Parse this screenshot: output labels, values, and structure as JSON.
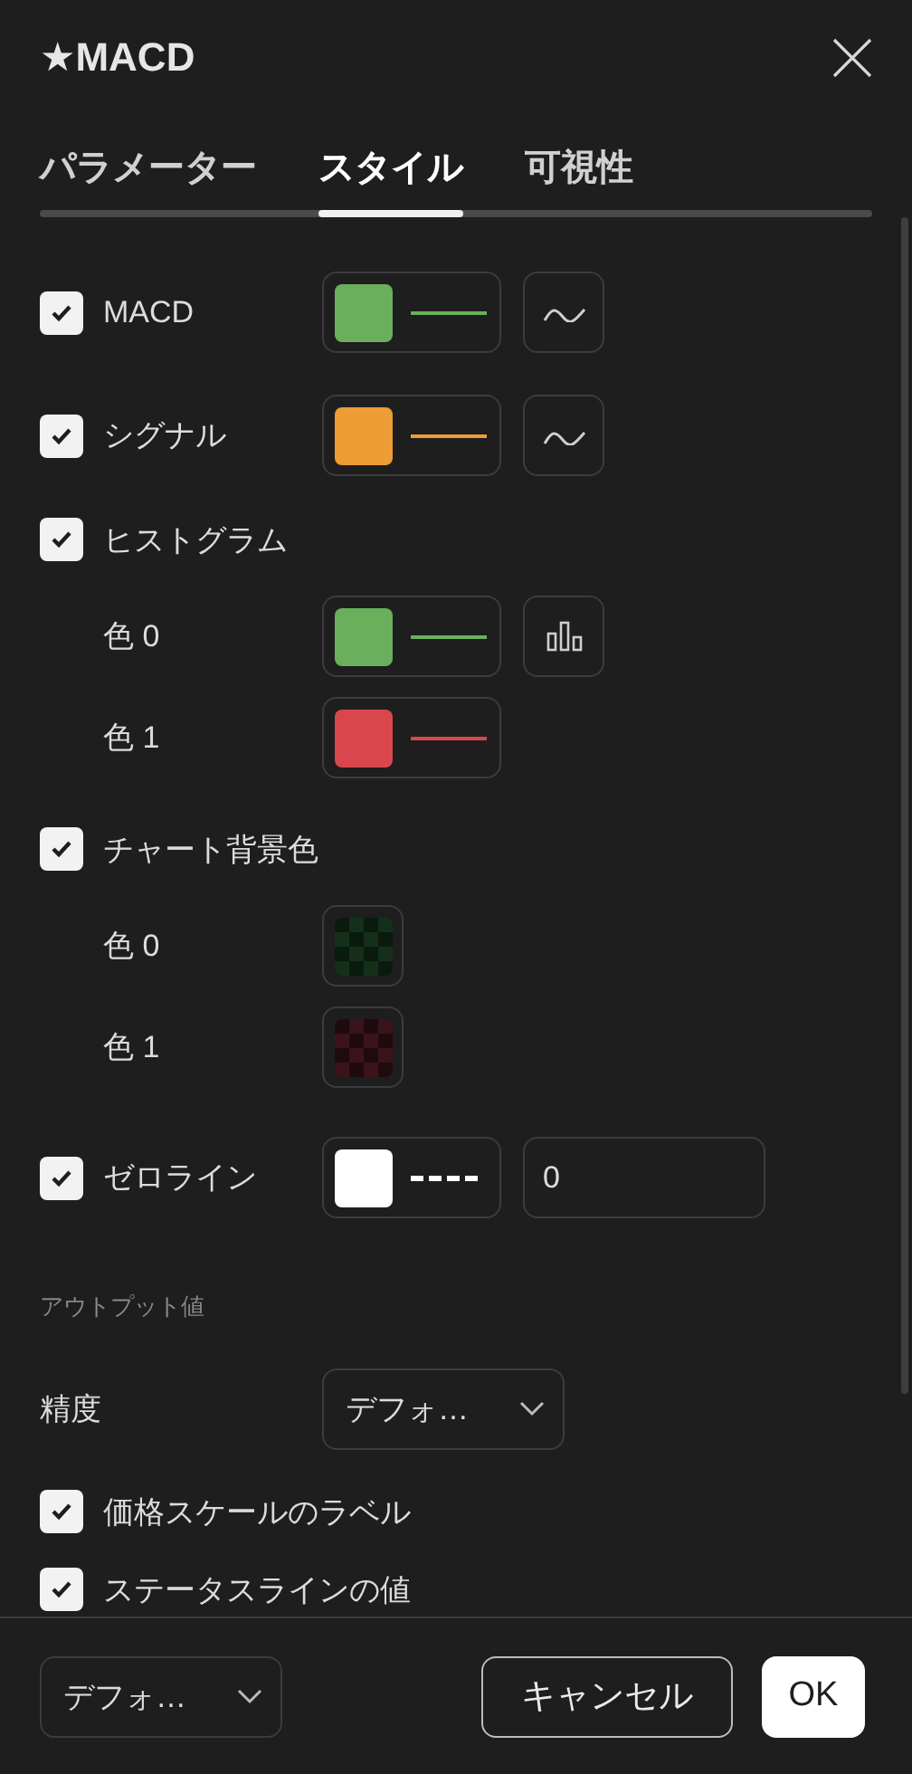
{
  "dialog": {
    "title": "★MACD"
  },
  "tabs": [
    {
      "label": "パラメーター",
      "selected": false
    },
    {
      "label": "スタイル",
      "selected": true
    },
    {
      "label": "可視性",
      "selected": false
    }
  ],
  "rows": [
    {
      "kind": "plot",
      "label": "MACD",
      "checked": true,
      "color": "#6aaf5c",
      "dashed": false,
      "style_button": {
        "kind": "line"
      }
    },
    {
      "kind": "plot",
      "label": "シグナル",
      "checked": true,
      "color": "#ee9c35",
      "dashed": false,
      "style_button": {
        "kind": "line"
      }
    },
    {
      "kind": "plot",
      "label": "ヒストグラム",
      "checked": true
    },
    {
      "kind": "color",
      "label": "色 0",
      "color": "#6aaf5c",
      "dashed": false,
      "style_button": {
        "kind": "columns"
      }
    },
    {
      "kind": "color",
      "label": "色 1",
      "color": "#d9474d",
      "dashed": false
    },
    {
      "kind": "plot",
      "label": "チャート背景色",
      "checked": true
    },
    {
      "kind": "background",
      "label": "色 0",
      "color": "#14301a"
    },
    {
      "kind": "background",
      "label": "色 1",
      "color": "#3a141a"
    },
    {
      "kind": "plot",
      "label": "ゼロライン",
      "checked": true,
      "color": "#ffffff",
      "dashed": true,
      "value": "0"
    },
    {
      "kind": "section",
      "label": "アウトプット値"
    },
    {
      "kind": "select",
      "label": "精度",
      "value": "デフォ…"
    },
    {
      "kind": "check",
      "label": "価格スケールのラベル",
      "checked": true
    },
    {
      "kind": "check",
      "label": "ステータスラインの値",
      "checked": true
    }
  ],
  "footer": {
    "template": "デフォ…",
    "buttons": [
      "キャンセル",
      "OK"
    ]
  }
}
